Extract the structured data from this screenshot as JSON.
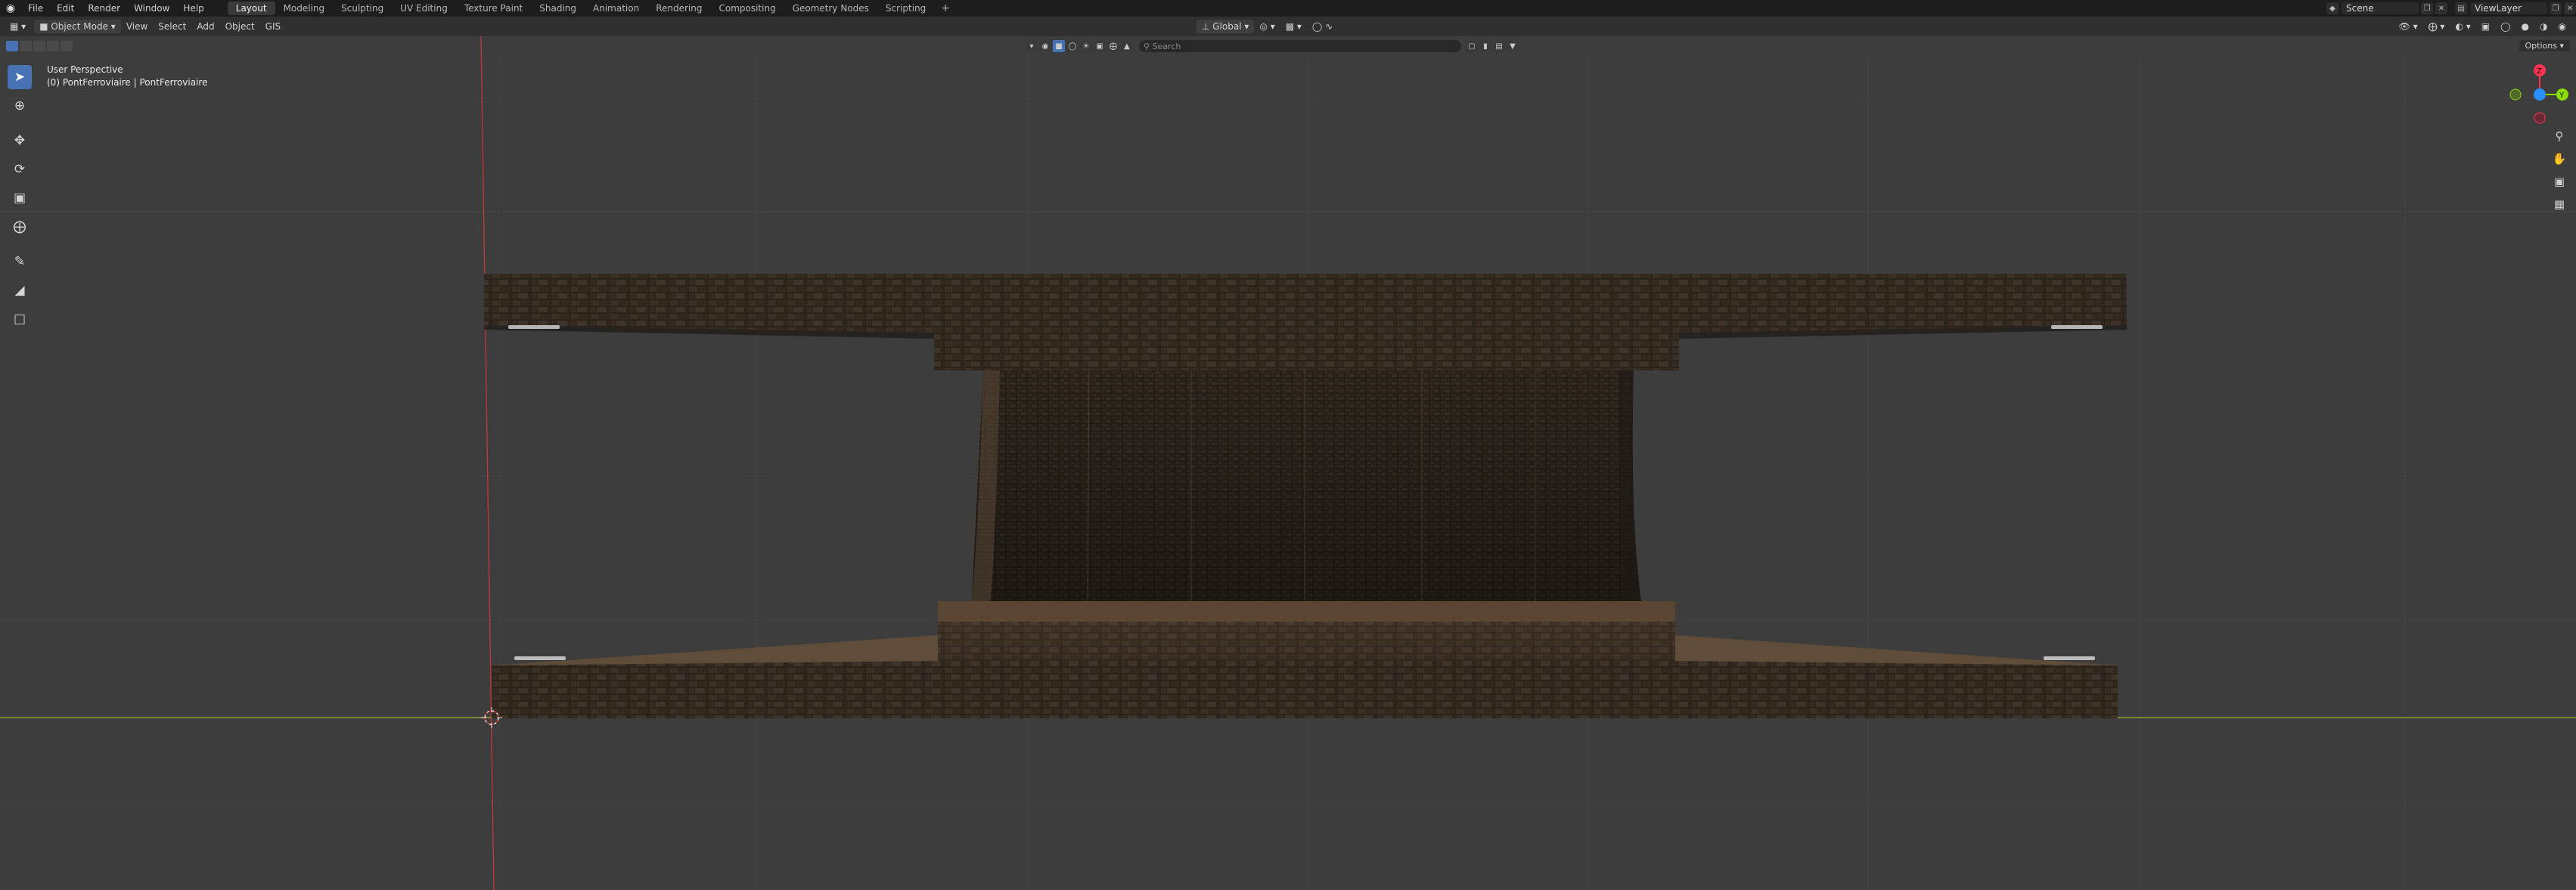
{
  "menubar": {
    "items": [
      "File",
      "Edit",
      "Render",
      "Window",
      "Help"
    ],
    "workspaces": [
      "Layout",
      "Modeling",
      "Sculpting",
      "UV Editing",
      "Texture Paint",
      "Shading",
      "Animation",
      "Rendering",
      "Compositing",
      "Geometry Nodes",
      "Scripting"
    ],
    "active_workspace": "Layout",
    "add_tab": "+",
    "scene_label": "Scene",
    "view_layer_label": "ViewLayer"
  },
  "viewport_header": {
    "mode": "Object Mode",
    "menus": [
      "View",
      "Select",
      "Add",
      "Object",
      "GIS"
    ],
    "transform_orientation": "Global"
  },
  "tool_header": {
    "search_placeholder": "Search",
    "options_label": "Options"
  },
  "overlay": {
    "view_name": "User Perspective",
    "object_info": "(0) PontFerroviaire | PontFerroviaire"
  },
  "gizmo": {
    "axis_x": "X",
    "axis_y": "Y",
    "axis_z": "Z",
    "colors": {
      "x": "#ff3352",
      "y": "#8bdc00",
      "z": "#2890ff"
    }
  },
  "colors": {
    "accent": "#4772b3",
    "x_axis_line": "#b43a3a",
    "y_axis_line": "#8ca33a",
    "viewport_bg": "#3d3d3d"
  },
  "icons": {
    "tools": [
      "select-box-icon",
      "cursor-icon",
      "move-icon",
      "rotate-icon",
      "scale-icon",
      "transform-icon",
      "annotate-icon",
      "measure-icon",
      "add-cube-icon"
    ],
    "nav": [
      "zoom-icon",
      "pan-hand-icon",
      "camera-view-icon",
      "ortho-grid-icon"
    ]
  }
}
